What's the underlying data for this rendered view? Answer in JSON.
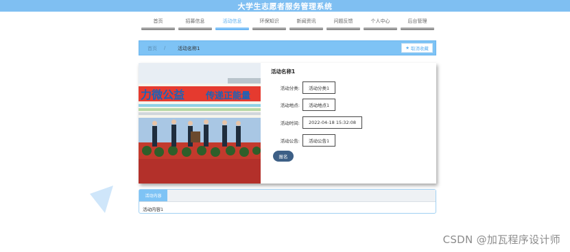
{
  "app": {
    "title": "大学生志愿者服务管理系统"
  },
  "nav": [
    {
      "label": "首页",
      "active": false
    },
    {
      "label": "招募信息",
      "active": false
    },
    {
      "label": "活动信息",
      "active": true
    },
    {
      "label": "环保知识",
      "active": false
    },
    {
      "label": "新闻资讯",
      "active": false
    },
    {
      "label": "问题反馈",
      "active": false
    },
    {
      "label": "个人中心",
      "active": false
    },
    {
      "label": "后台管理",
      "active": false
    }
  ],
  "breadcrumb": {
    "home": "首页",
    "separator": "/",
    "current": "活动名称1",
    "favorite_label": "取消收藏"
  },
  "activity": {
    "title": "活动名称1",
    "fields": [
      {
        "label": "活动分类:",
        "value": "活动分类1"
      },
      {
        "label": "活动地点:",
        "value": "活动地点1"
      },
      {
        "label": "活动时间:",
        "value": "2022-04-18 15:32:08"
      },
      {
        "label": "活动公告:",
        "value": "活动公告1"
      }
    ],
    "report_label": "报名",
    "banner_text_left": "力微公益",
    "banner_text_right": "传递正能量"
  },
  "detail": {
    "tab_label": "活动内容",
    "content": "活动内容1"
  },
  "watermark": "CSDN @加瓦程序设计师",
  "colors": {
    "primary": "#7ec3f5",
    "button": "#3d5f86"
  }
}
